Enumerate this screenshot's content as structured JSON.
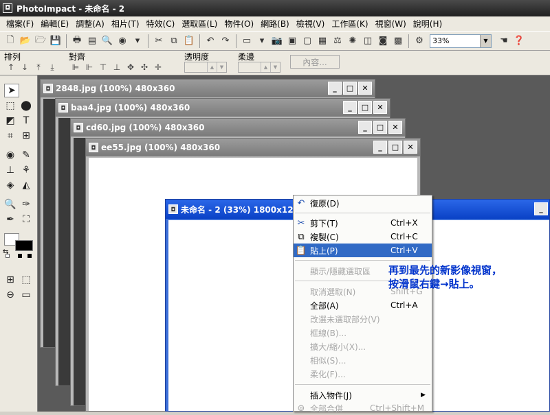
{
  "app": {
    "title": "PhotoImpact - 未命名 - 2"
  },
  "menubar": [
    "檔案(F)",
    "編輯(E)",
    "調整(A)",
    "相片(T)",
    "特效(C)",
    "選取區(L)",
    "物件(O)",
    "網路(B)",
    "檢視(V)",
    "工作區(K)",
    "視窗(W)",
    "說明(H)"
  ],
  "toolbar": {
    "zoom": "33%"
  },
  "attrbar": {
    "arrange_label": "排列",
    "align_label": "對齊",
    "transparency_label": "透明度",
    "soft_edge_label": "柔邊",
    "properties_button": "內容..."
  },
  "documents": [
    {
      "title": "2848.jpg (100%) 480x360"
    },
    {
      "title": "baa4.jpg (100%) 480x360"
    },
    {
      "title": "cd60.jpg (100%) 480x360"
    },
    {
      "title": "ee55.jpg (100%) 480x360"
    }
  ],
  "active_document": {
    "title": "未命名 - 2 (33%) 1800x1200"
  },
  "context_menu": {
    "undo": "復原(D)",
    "cut": "剪下(T)",
    "cut_key": "Ctrl+X",
    "copy": "複製(C)",
    "copy_key": "Ctrl+C",
    "paste": "貼上(P)",
    "paste_key": "Ctrl+V",
    "toggle_selection": "顯示/隱藏選取區",
    "deselect": "取消選取(N)",
    "deselect_key": "Shift+G",
    "select_all": "全部(A)",
    "select_all_key": "Ctrl+A",
    "invert": "改選未選取部分(V)",
    "border": "框線(B)...",
    "expand_shrink": "擴大/縮小(X)...",
    "similar": "相似(S)...",
    "soften": "柔化(F)...",
    "insert_object": "插入物件(J)",
    "merge_all": "全部合併",
    "merge_all_key": "Ctrl+Shift+M"
  },
  "annotation": {
    "line1": "再到最先的新影像視窗，",
    "line2": "按滑鼠右鍵→貼上。"
  }
}
